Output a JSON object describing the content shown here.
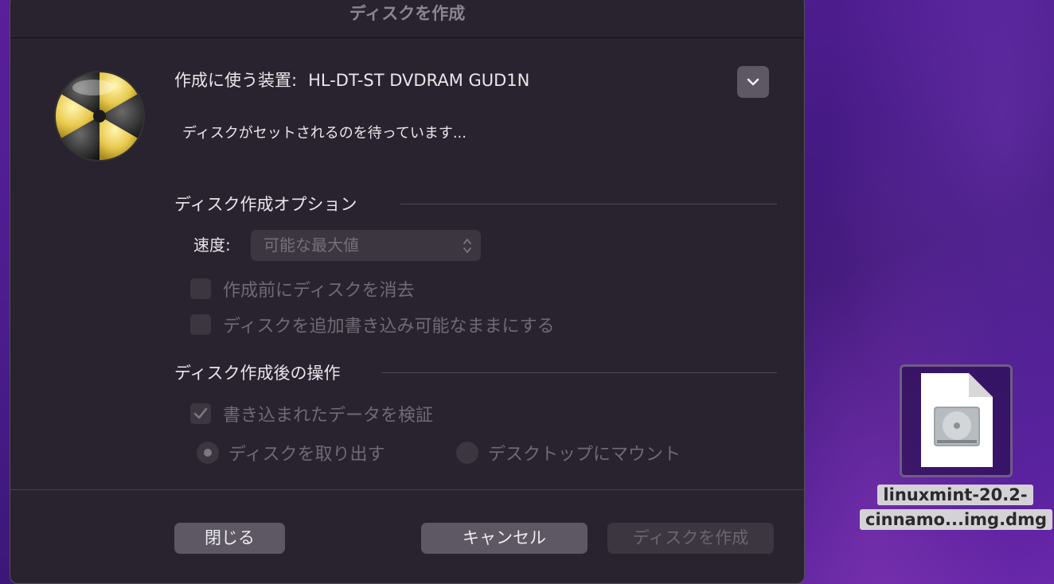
{
  "dialog": {
    "title": "ディスクを作成",
    "device_prefix": "作成に使う装置:",
    "device_name": "HL-DT-ST DVDRAM GUD1N",
    "device_toggle_icon": "chevron-down-icon",
    "status": "ディスクがセットされるのを待っています..."
  },
  "burn_options": {
    "heading": "ディスク作成オプション",
    "speed_label": "速度:",
    "speed_value": "可能な最大値",
    "erase_before": {
      "label": "作成前にディスクを消去",
      "checked": false,
      "enabled": false
    },
    "appendable": {
      "label": "ディスクを追加書き込み可能なままにする",
      "checked": false,
      "enabled": false
    }
  },
  "after_burn": {
    "heading": "ディスク作成後の操作",
    "verify": {
      "label": "書き込まれたデータを検証",
      "checked": true,
      "enabled": false
    },
    "eject": {
      "label": "ディスクを取り出す",
      "selected": true
    },
    "mount": {
      "label": "デスクトップにマウント",
      "selected": false
    }
  },
  "buttons": {
    "close": "閉じる",
    "cancel": "キャンセル",
    "burn": "ディスクを作成"
  },
  "desktop": {
    "file_label_line1": "linuxmint-20.2-",
    "file_label_line2": "cinnamo...img.dmg",
    "file_icon": "disk-image-icon"
  },
  "colors": {
    "dialog_bg": "#29232f",
    "button_bg": "#5d5863",
    "desktop_bg": "#4b1c8c",
    "burn_yellow": "#f2d86a"
  }
}
